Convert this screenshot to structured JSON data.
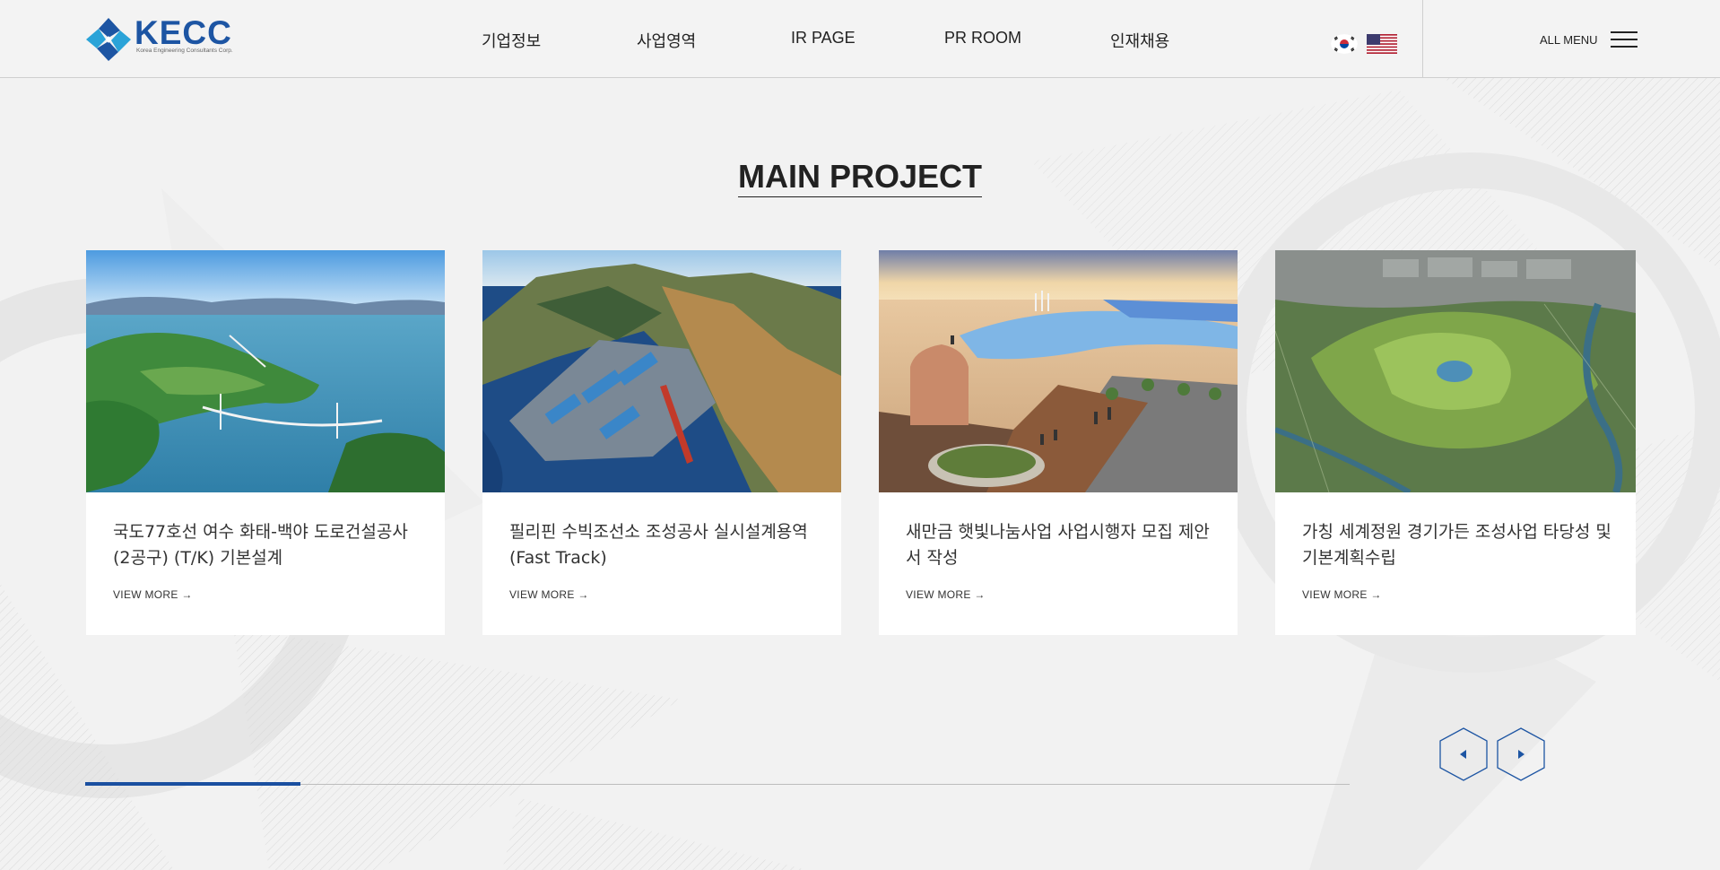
{
  "brand": {
    "logo_name": "KECC",
    "logo_sub": "Korea Engineering Consultants Corp.",
    "primary_color": "#1d55a3"
  },
  "nav": {
    "items": [
      {
        "label": "기업정보"
      },
      {
        "label": "사업영역"
      },
      {
        "label": "IR PAGE"
      },
      {
        "label": "PR ROOM"
      },
      {
        "label": "인재채용"
      }
    ],
    "languages": [
      {
        "icon": "korean-flag-icon"
      },
      {
        "icon": "us-flag-icon"
      }
    ],
    "all_menu_label": "ALL MENU",
    "all_menu_icon": "hamburger-menu-icon"
  },
  "section": {
    "title": "MAIN PROJECT"
  },
  "projects": [
    {
      "title": "국도77호선 여수 화태-백야 도로건설공사 (2공구) (T/K) 기본설계",
      "more": "VIEW MORE →",
      "image": "bridge-islands-photo"
    },
    {
      "title": "필리핀 수빅조선소 조성공사 실시설계용역 (Fast Track)",
      "more": "VIEW MORE →",
      "image": "shipyard-aerial-photo"
    },
    {
      "title": "새만금 햇빛나눔사업 사업시행자 모집 제안서 작성",
      "more": "VIEW MORE →",
      "image": "solar-farm-rendering"
    },
    {
      "title": "가칭 세계정원 경기가든 조성사업 타당성 및 기본계획수립",
      "more": "VIEW MORE →",
      "image": "garden-aerial-photo"
    }
  ],
  "slider": {
    "progress_fraction": 0.17,
    "prev_icon": "chevron-left-icon",
    "next_icon": "chevron-right-icon",
    "accent_color": "#1a4fa0"
  }
}
